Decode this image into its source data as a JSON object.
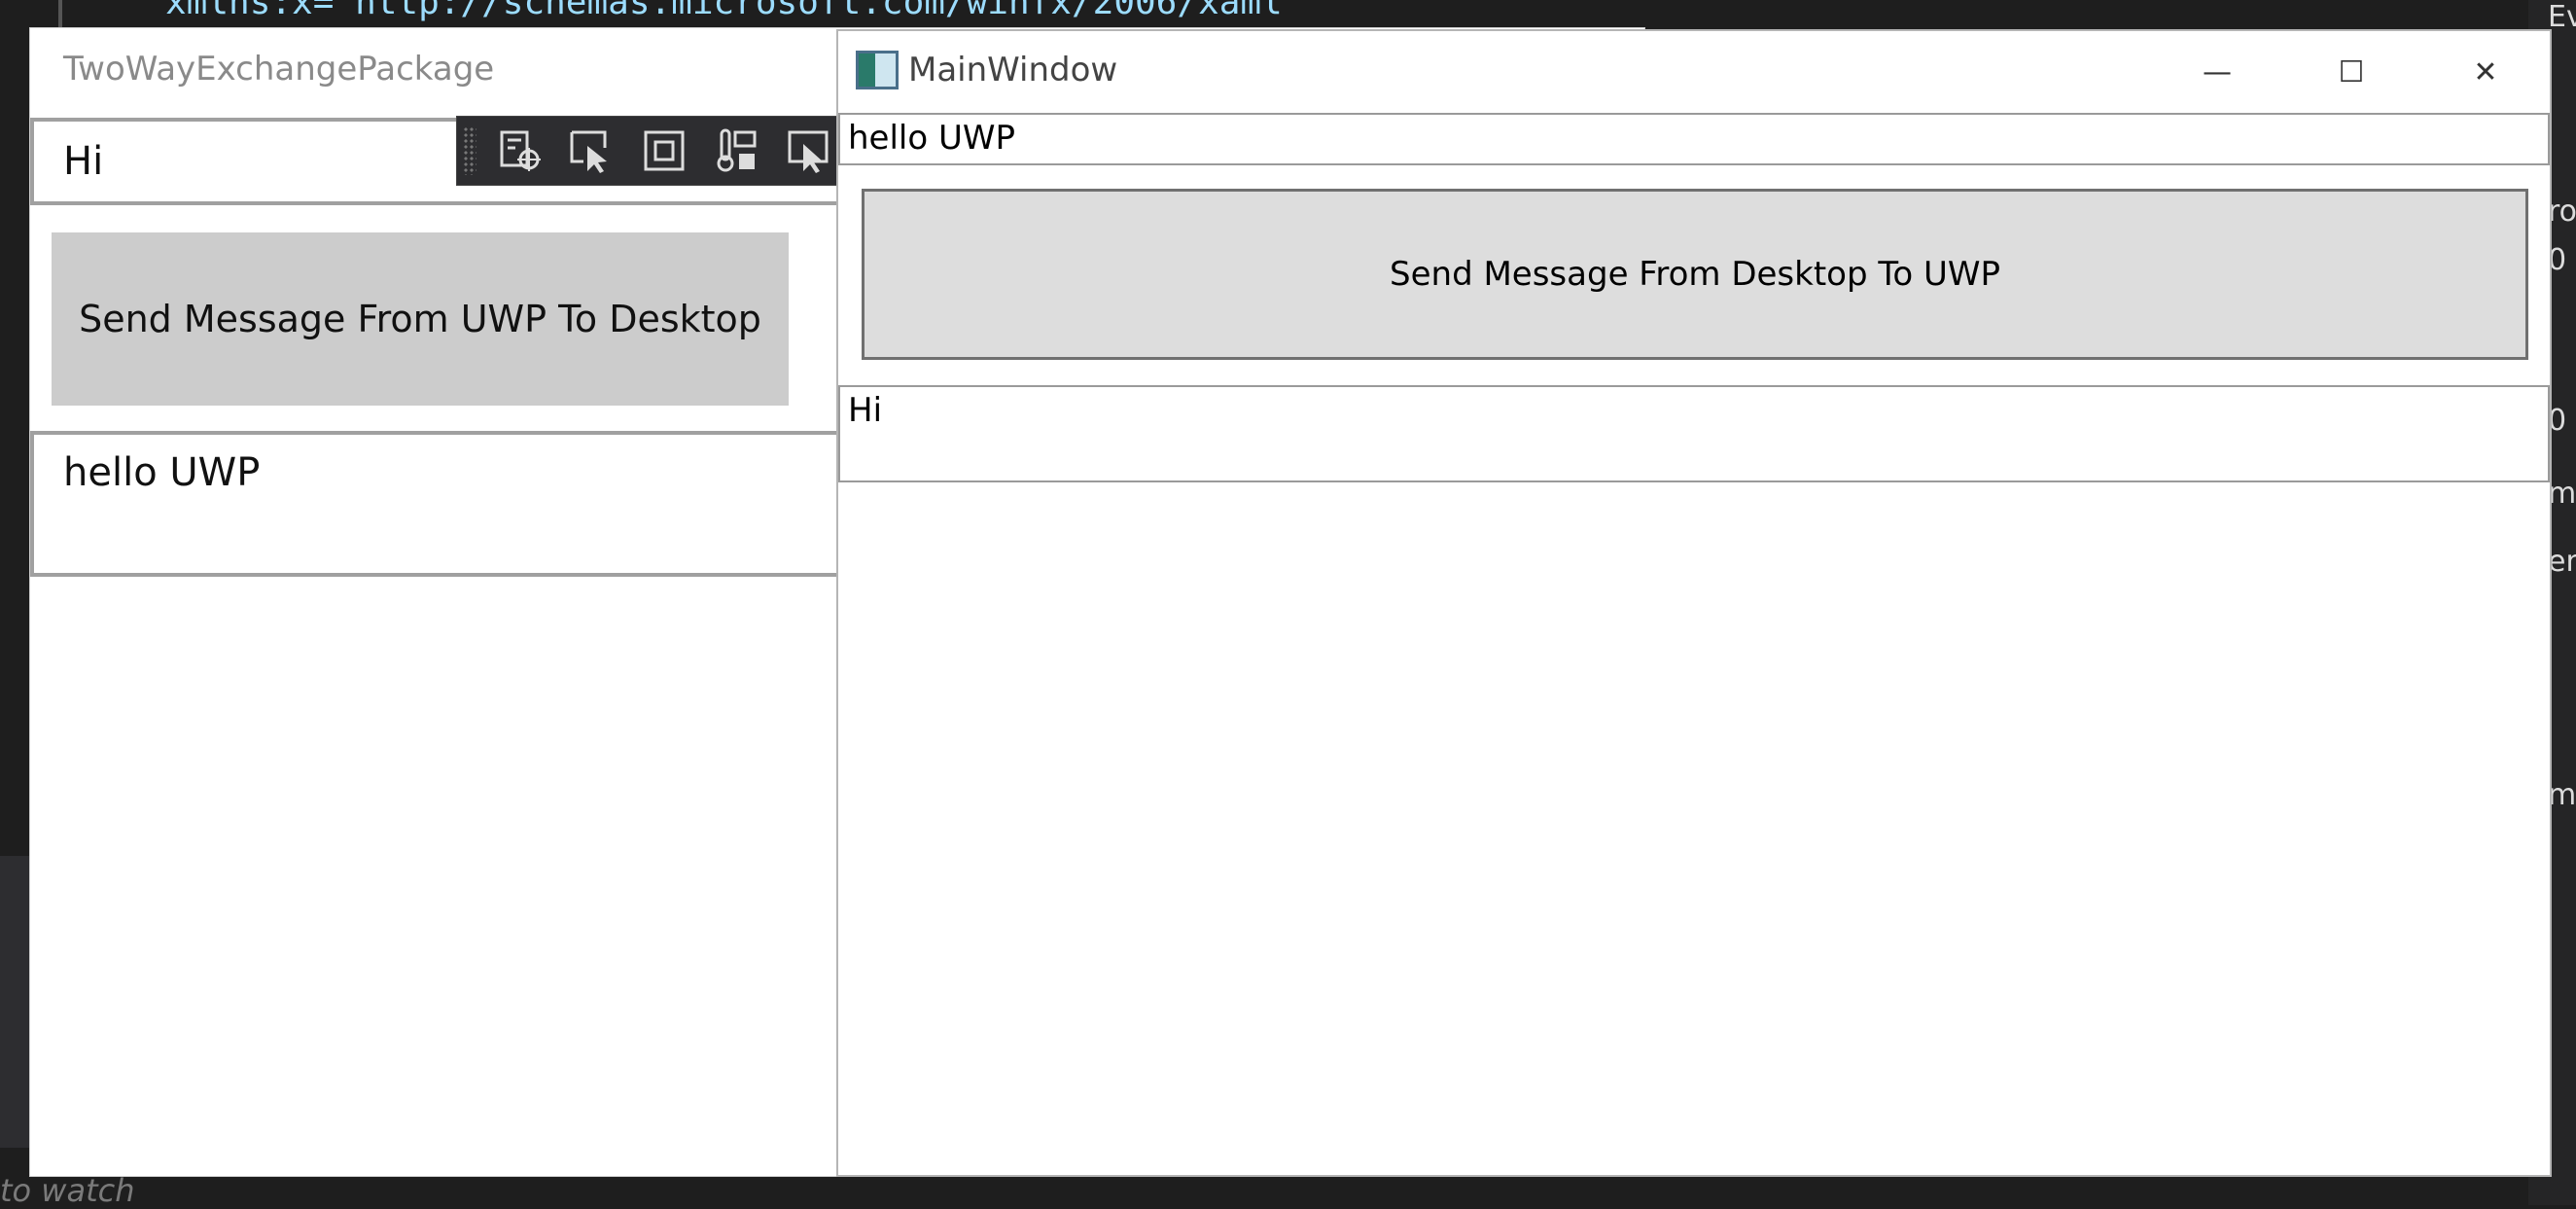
{
  "ide": {
    "code_line": "xmlns:x=\"http://schemas.microsoft.com/winfx/2006/xaml\"",
    "right_panel": [
      "Eve",
      "ro",
      "0",
      "0",
      "m",
      "en",
      "m"
    ],
    "watch_hint": "to watch"
  },
  "uwp_window": {
    "title": "TwoWayExchangePackage",
    "input_text": "Hi",
    "send_button_label": "Send Message From UWP To Desktop",
    "received_text": "hello UWP",
    "devtools": [
      "live-visual-tree-icon",
      "select-element-icon",
      "display-adorners-icon",
      "track-focus-icon",
      "preview-selection-icon"
    ]
  },
  "wpf_window": {
    "title": "MainWindow",
    "input_text": "hello UWP",
    "send_button_label": "Send Message From Desktop To UWP",
    "received_text": "Hi",
    "minimize_glyph": "—",
    "maximize_glyph": "☐",
    "close_glyph": "✕"
  }
}
